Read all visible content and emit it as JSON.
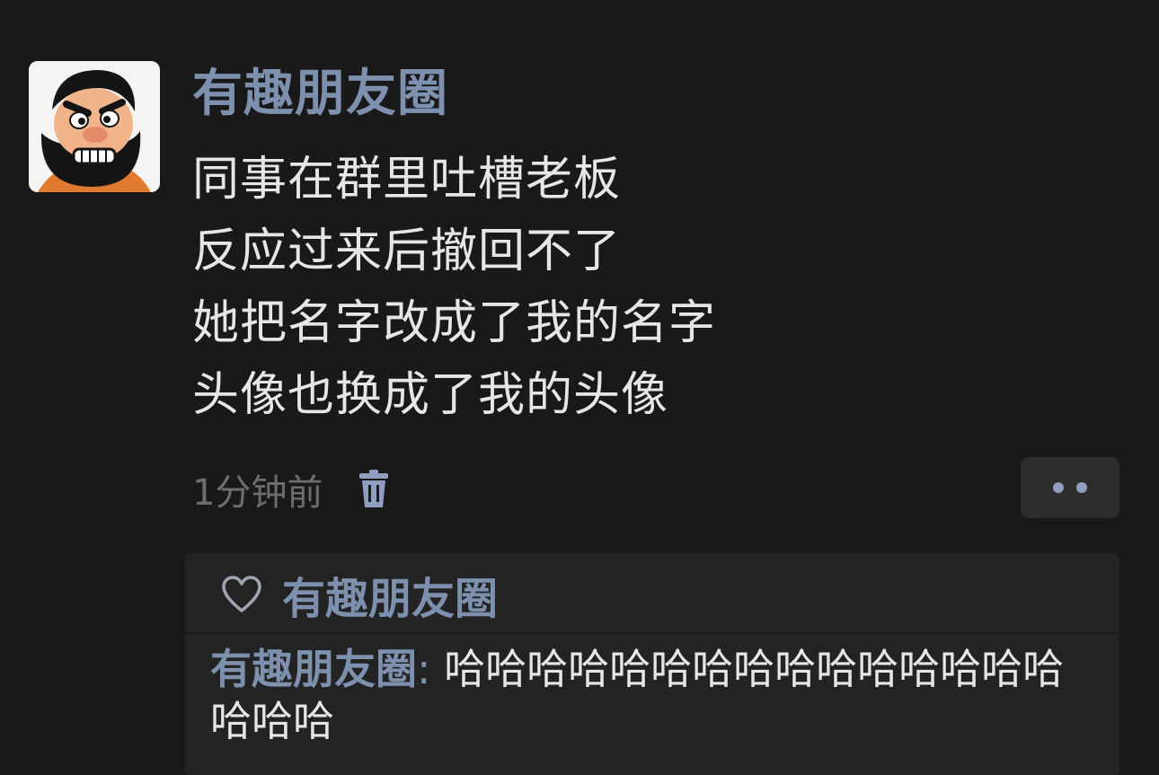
{
  "post": {
    "author": "有趣朋友圈",
    "avatar_icon": "cartoon-bearded-man-avatar",
    "lines": [
      "同事在群里吐槽老板",
      "反应过来后撤回不了",
      "她把名字改成了我的名字",
      "头像也换成了我的头像"
    ],
    "timestamp": "1分钟前",
    "delete_icon": "trash-icon",
    "more_icon": "more-dots-icon"
  },
  "likes": {
    "icon": "heart-outline-icon",
    "names": "有趣朋友圈"
  },
  "comment": {
    "author": "有趣朋友圈",
    "separator": ": ",
    "text": "哈哈哈哈哈哈哈哈哈哈哈哈哈哈哈哈哈哈"
  },
  "colors": {
    "background": "#191919",
    "name_blue": "#7d90ad",
    "text": "#e6e6e6",
    "muted": "#6d6d6d",
    "panel": "#232323"
  }
}
